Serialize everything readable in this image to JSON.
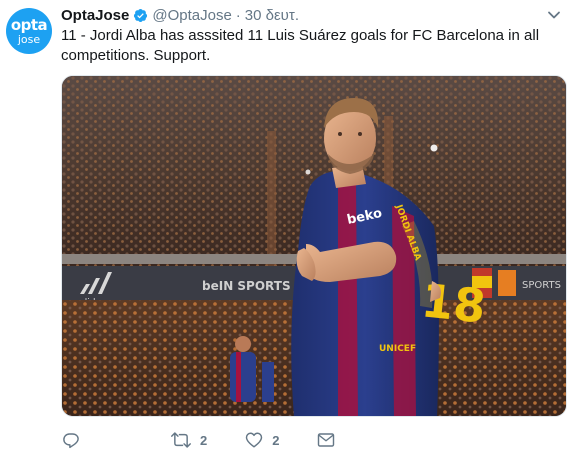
{
  "author": {
    "name": "OptaJose",
    "handle": "@OptaJose",
    "avatar_text_line1": "opta",
    "avatar_text_line2": "jose",
    "verified": true
  },
  "timestamp": "30 δευτ.",
  "separator": "·",
  "tweet_text": "11 - Jordi Alba has asssited 11 Luis Suárez goals for FC Barcelona in all competitions. Support.",
  "photo": {
    "shirt_sponsor": "beko",
    "shirt_number": "18",
    "shirt_name": "JORDI ALBA",
    "shorts_brand": "UNICEF",
    "board_brand_left": "adidas",
    "board_brand_mid": "beIN SPORTS",
    "board_brand_right": "SPORTS"
  },
  "actions": {
    "reply_count": "",
    "retweet_count": "2",
    "like_count": "2"
  },
  "colors": {
    "brand_blue": "#1da1f2",
    "muted_text": "#657786"
  },
  "icons": {
    "verified": "verified-badge-icon",
    "caret": "chevron-down-icon",
    "reply": "reply-icon",
    "retweet": "retweet-icon",
    "like": "heart-icon",
    "message": "direct-message-icon"
  }
}
